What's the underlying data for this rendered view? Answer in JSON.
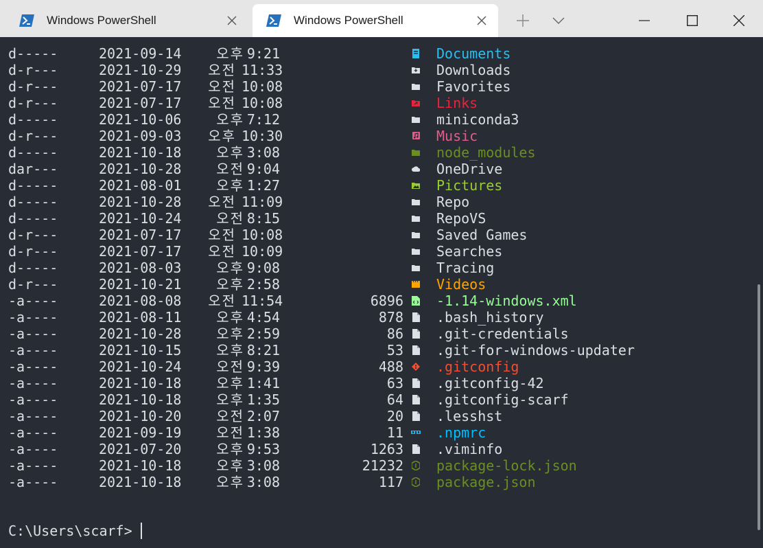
{
  "window": {
    "tabs": [
      {
        "title": "Windows PowerShell",
        "active": false,
        "icon": "powershell-icon"
      },
      {
        "title": "Windows PowerShell",
        "active": true,
        "icon": "powershell-icon"
      }
    ],
    "controls": {
      "new_tab_icon": "plus-icon",
      "dropdown_icon": "chevron-down-icon",
      "minimize_icon": "minimize-icon",
      "maximize_icon": "maximize-icon",
      "close_icon": "close-icon"
    },
    "colors": {
      "titlebar_bg": "#e6e6e6",
      "terminal_bg": "#282c34",
      "text": "#dcdfe4"
    }
  },
  "listing": [
    {
      "mode": "d-----",
      "date": "2021-09-14",
      "ampm": "오후",
      "time": "9:21",
      "length": "",
      "icon": "documents-folder-icon",
      "name": "Documents",
      "color": "#2bbef0"
    },
    {
      "mode": "d-r---",
      "date": "2021-10-29",
      "ampm": "오전",
      "time": "11:33",
      "length": "",
      "icon": "downloads-folder-icon",
      "name": "Downloads",
      "color": "#dcdfe4"
    },
    {
      "mode": "d-r---",
      "date": "2021-07-17",
      "ampm": "오전",
      "time": "10:08",
      "length": "",
      "icon": "folder-icon",
      "name": "Favorites",
      "color": "#dcdfe4"
    },
    {
      "mode": "d-r---",
      "date": "2021-07-17",
      "ampm": "오전",
      "time": "10:08",
      "length": "",
      "icon": "links-folder-icon",
      "name": "Links",
      "color": "#e8243c"
    },
    {
      "mode": "d-----",
      "date": "2021-10-06",
      "ampm": "오후",
      "time": "7:12",
      "length": "",
      "icon": "folder-icon",
      "name": "miniconda3",
      "color": "#dcdfe4"
    },
    {
      "mode": "d-r---",
      "date": "2021-09-03",
      "ampm": "오후",
      "time": "10:30",
      "length": "",
      "icon": "music-folder-icon",
      "name": "Music",
      "color": "#e05f8a"
    },
    {
      "mode": "d-----",
      "date": "2021-10-18",
      "ampm": "오후",
      "time": "3:08",
      "length": "",
      "icon": "node-folder-icon",
      "name": "node_modules",
      "color": "#6b8e23"
    },
    {
      "mode": "dar---",
      "date": "2021-10-28",
      "ampm": "오전",
      "time": "9:04",
      "length": "",
      "icon": "cloud-icon",
      "name": "OneDrive",
      "color": "#dcdfe4"
    },
    {
      "mode": "d-----",
      "date": "2021-08-01",
      "ampm": "오후",
      "time": "1:27",
      "length": "",
      "icon": "pictures-folder-icon",
      "name": "Pictures",
      "color": "#9acd32"
    },
    {
      "mode": "d-----",
      "date": "2021-10-28",
      "ampm": "오전",
      "time": "11:09",
      "length": "",
      "icon": "folder-icon",
      "name": "Repo",
      "color": "#dcdfe4"
    },
    {
      "mode": "d-----",
      "date": "2021-10-24",
      "ampm": "오전",
      "time": "8:15",
      "length": "",
      "icon": "folder-icon",
      "name": "RepoVS",
      "color": "#dcdfe4"
    },
    {
      "mode": "d-r---",
      "date": "2021-07-17",
      "ampm": "오전",
      "time": "10:08",
      "length": "",
      "icon": "folder-icon",
      "name": "Saved Games",
      "color": "#dcdfe4"
    },
    {
      "mode": "d-r---",
      "date": "2021-07-17",
      "ampm": "오전",
      "time": "10:09",
      "length": "",
      "icon": "folder-icon",
      "name": "Searches",
      "color": "#dcdfe4"
    },
    {
      "mode": "d-----",
      "date": "2021-08-03",
      "ampm": "오후",
      "time": "9:08",
      "length": "",
      "icon": "folder-icon",
      "name": "Tracing",
      "color": "#dcdfe4"
    },
    {
      "mode": "d-r---",
      "date": "2021-10-21",
      "ampm": "오후",
      "time": "2:58",
      "length": "",
      "icon": "videos-folder-icon",
      "name": "Videos",
      "color": "#ffa500"
    },
    {
      "mode": "-a----",
      "date": "2021-08-08",
      "ampm": "오전",
      "time": "11:54",
      "length": "6896",
      "icon": "xml-file-icon",
      "name": "-1.14-windows.xml",
      "color": "#98fb98"
    },
    {
      "mode": "-a----",
      "date": "2021-08-11",
      "ampm": "오후",
      "time": "4:54",
      "length": "878",
      "icon": "file-icon",
      "name": ".bash_history",
      "color": "#dcdfe4"
    },
    {
      "mode": "-a----",
      "date": "2021-10-28",
      "ampm": "오후",
      "time": "2:59",
      "length": "86",
      "icon": "file-icon",
      "name": ".git-credentials",
      "color": "#dcdfe4"
    },
    {
      "mode": "-a----",
      "date": "2021-10-15",
      "ampm": "오후",
      "time": "8:21",
      "length": "53",
      "icon": "file-icon",
      "name": ".git-for-windows-updater",
      "color": "#dcdfe4"
    },
    {
      "mode": "-a----",
      "date": "2021-10-24",
      "ampm": "오전",
      "time": "9:39",
      "length": "488",
      "icon": "git-icon",
      "name": ".gitconfig",
      "color": "#f14e32"
    },
    {
      "mode": "-a----",
      "date": "2021-10-18",
      "ampm": "오후",
      "time": "1:41",
      "length": "63",
      "icon": "file-icon",
      "name": ".gitconfig-42",
      "color": "#dcdfe4"
    },
    {
      "mode": "-a----",
      "date": "2021-10-18",
      "ampm": "오후",
      "time": "1:35",
      "length": "64",
      "icon": "file-icon",
      "name": ".gitconfig-scarf",
      "color": "#dcdfe4"
    },
    {
      "mode": "-a----",
      "date": "2021-10-20",
      "ampm": "오전",
      "time": "2:07",
      "length": "20",
      "icon": "file-icon",
      "name": ".lesshst",
      "color": "#dcdfe4"
    },
    {
      "mode": "-a----",
      "date": "2021-09-19",
      "ampm": "오전",
      "time": "1:38",
      "length": "11",
      "icon": "npm-icon",
      "name": ".npmrc",
      "color": "#00bfff"
    },
    {
      "mode": "-a----",
      "date": "2021-07-20",
      "ampm": "오후",
      "time": "9:53",
      "length": "1263",
      "icon": "file-icon",
      "name": ".viminfo",
      "color": "#dcdfe4"
    },
    {
      "mode": "-a----",
      "date": "2021-10-18",
      "ampm": "오후",
      "time": "3:08",
      "length": "21232",
      "icon": "nodejs-icon",
      "name": "package-lock.json",
      "color": "#6b8e23"
    },
    {
      "mode": "-a----",
      "date": "2021-10-18",
      "ampm": "오후",
      "time": "3:08",
      "length": "117",
      "icon": "nodejs-icon",
      "name": "package.json",
      "color": "#6b8e23"
    }
  ],
  "prompt": "C:\\Users\\scarf>"
}
